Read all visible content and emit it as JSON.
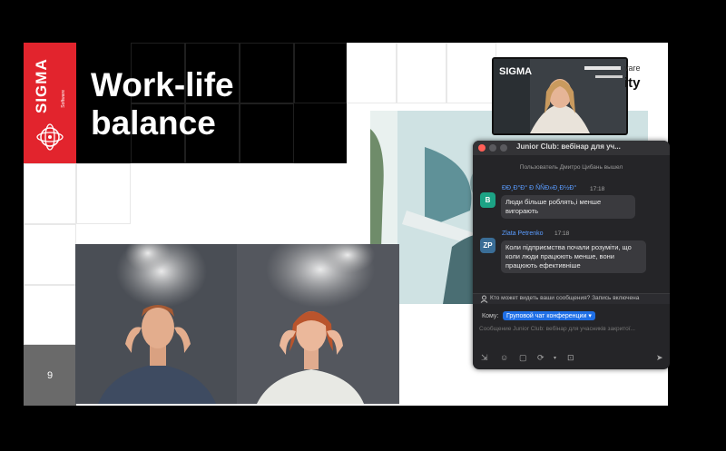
{
  "slide": {
    "logo": "SIGMA",
    "logo_sub": "Software",
    "title": "Work-life\nbalance",
    "page_number": "9"
  },
  "video": {
    "logo": "SIGMA",
    "bg_text_1": "vare",
    "bg_text_2": "ity"
  },
  "chat": {
    "title": "Junior Club: вебінар для уч...",
    "notice": "Пользователь Дмитро Цибань вышел",
    "messages": [
      {
        "avatar": "B",
        "avatar_color": "#1ca385",
        "sender": "ÐÐ¸Ð°Ð° Ð ÑÑÐ»Ð¸Ð½Ð°",
        "time": "17:18",
        "text": "Люди більше роблять,і менше вигорають"
      },
      {
        "avatar": "ZP",
        "avatar_color": "#3a6d96",
        "sender": "Zlata Petrenko",
        "time": "17:18",
        "text": "Коли підприємства почали розуміти, що коли люди працюють менше, вони працюють ефективніше"
      }
    ],
    "privacy_text": "Кто может видеть ваши сообщения? Запись включена",
    "to_label": "Кому:",
    "to_value": "Груповой чат конференции",
    "input_placeholder": "Сообщение Junior Club: вебінар для учасників закритої...",
    "accent_color": "#1f6fe6"
  }
}
